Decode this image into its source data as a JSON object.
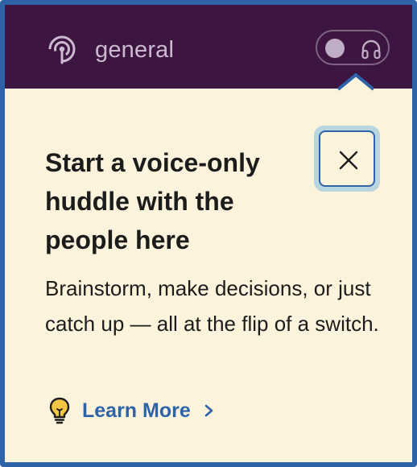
{
  "header": {
    "channel_name": "general",
    "channel_icon": "broadcast-icon",
    "huddle_toggle_icon": "headphones-icon"
  },
  "popover": {
    "title": "Start a voice-only huddle with the people here",
    "body": "Brainstorm, make decisions, or just catch up — all at the flip of a switch.",
    "close_icon": "close-icon",
    "learn_more_label": "Learn More",
    "learn_more_icon": "lightbulb-icon",
    "learn_more_chevron": "chevron-right-icon"
  },
  "colors": {
    "header_bg": "#3c1540",
    "popover_bg": "#fbf3dc",
    "accent": "#2f63a8",
    "text": "#1d1c1d"
  }
}
